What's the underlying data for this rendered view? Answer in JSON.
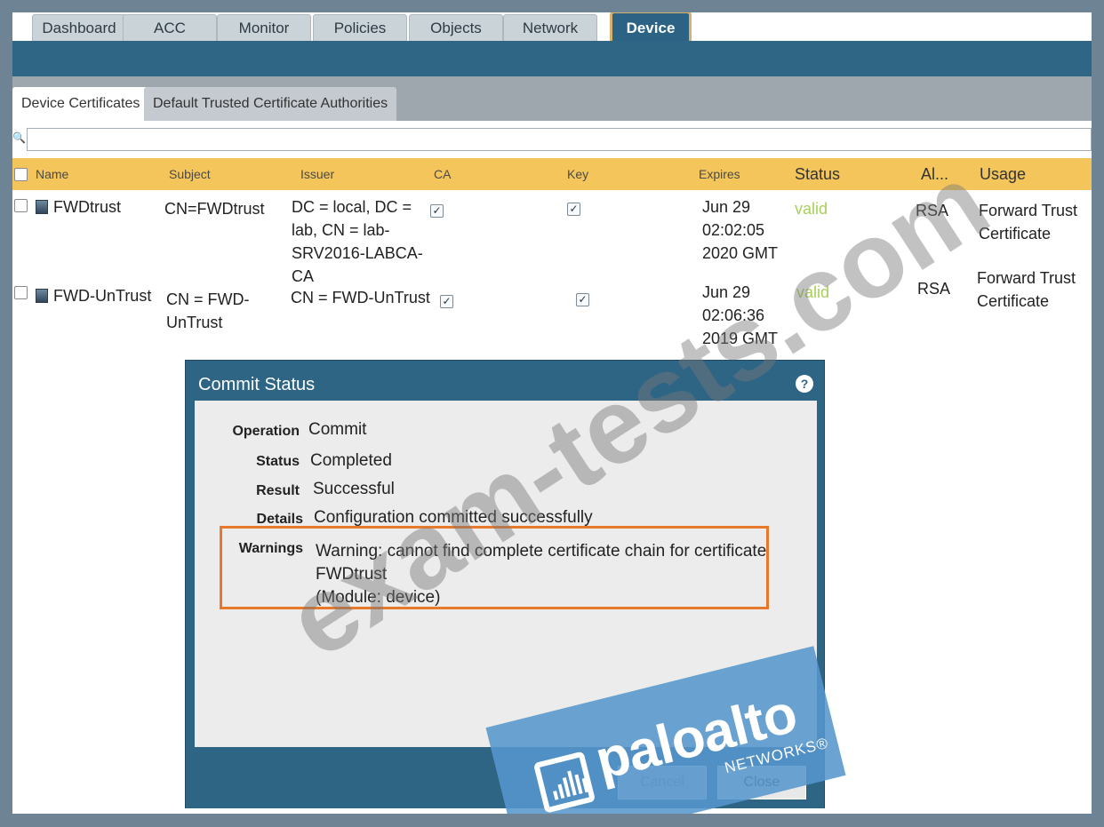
{
  "nav": {
    "tabs": [
      "Dashboard",
      "ACC",
      "Monitor",
      "Policies",
      "Objects",
      "Network",
      "Device"
    ],
    "active": "Device"
  },
  "subtabs": [
    "Device Certificates",
    "Default Trusted Certificate Authorities"
  ],
  "table": {
    "columns": [
      "Name",
      "Subject",
      "Issuer",
      "CA",
      "Key",
      "Expires",
      "Status",
      "Al...",
      "Usage"
    ],
    "rows": [
      {
        "name": "FWDtrust",
        "subject": "CN=FWDtrust",
        "issuer_lines": [
          "DC = local, DC =",
          "lab, CN = lab-",
          "SRV2016-LABCA-",
          "CA"
        ],
        "expires_lines": [
          "Jun 29",
          "02:02:05",
          "2020 GMT"
        ],
        "status": "valid",
        "alg": "RSA",
        "usage_lines": [
          "Forward Trust",
          "Certificate"
        ]
      },
      {
        "name": "FWD-UnTrust",
        "subject_lines": [
          "CN = FWD-",
          "UnTrust"
        ],
        "issuer": "CN = FWD-UnTrust",
        "expires_lines": [
          "Jun 29",
          "02:06:36",
          "2019 GMT"
        ],
        "status": "valid",
        "alg": "RSA",
        "usage_lines": [
          "Forward Trust",
          "Certificate"
        ]
      }
    ]
  },
  "modal": {
    "title": "Commit Status",
    "fields": {
      "operation_label": "Operation",
      "operation": "Commit",
      "status_label": "Status",
      "status": "Completed",
      "result_label": "Result",
      "result": "Successful",
      "details_label": "Details",
      "details": "Configuration committed successfully",
      "warnings_label": "Warnings",
      "warning_lines": [
        "Warning: cannot find complete certificate chain for certificate",
        "FWDtrust",
        "(Module: device)"
      ]
    },
    "cancel_label": "Cancel",
    "close_label": "Close"
  },
  "watermark": "exam-tests.com",
  "logo": {
    "word": "paloalto",
    "sub": "NETWORKS®"
  },
  "colors": {
    "accent": "#2f6585",
    "header": "#f4c55a",
    "warning_border": "#e8792b",
    "valid": "#a8d05a"
  }
}
